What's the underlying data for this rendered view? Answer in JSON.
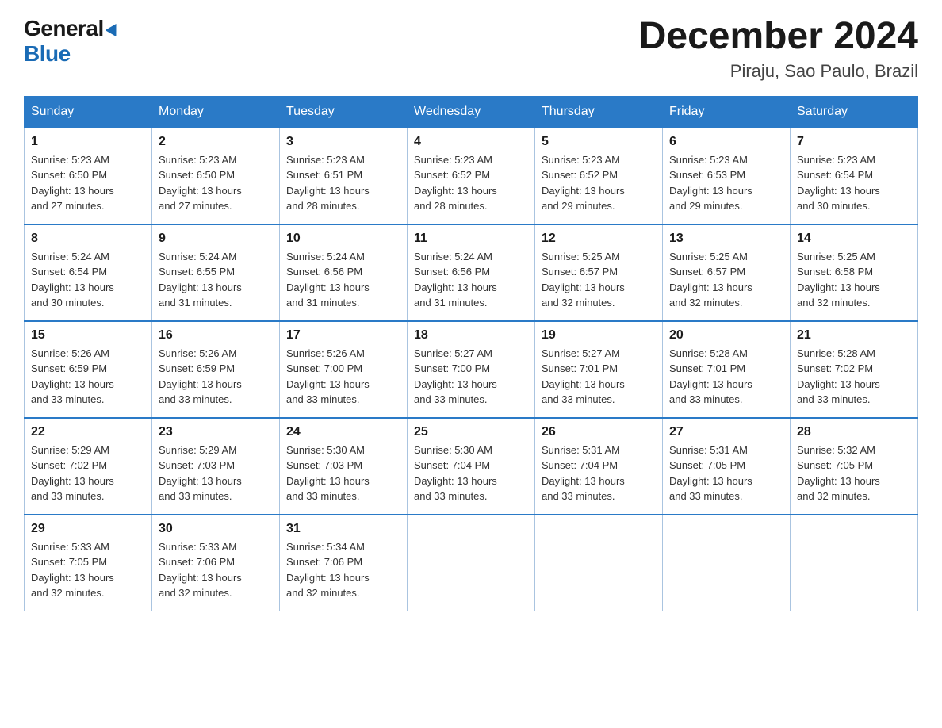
{
  "header": {
    "logo_general": "General",
    "logo_blue": "Blue",
    "month_title": "December 2024",
    "subtitle": "Piraju, Sao Paulo, Brazil"
  },
  "calendar": {
    "days_of_week": [
      "Sunday",
      "Monday",
      "Tuesday",
      "Wednesday",
      "Thursday",
      "Friday",
      "Saturday"
    ],
    "weeks": [
      [
        {
          "num": "1",
          "sunrise": "5:23 AM",
          "sunset": "6:50 PM",
          "daylight": "13 hours and 27 minutes."
        },
        {
          "num": "2",
          "sunrise": "5:23 AM",
          "sunset": "6:50 PM",
          "daylight": "13 hours and 27 minutes."
        },
        {
          "num": "3",
          "sunrise": "5:23 AM",
          "sunset": "6:51 PM",
          "daylight": "13 hours and 28 minutes."
        },
        {
          "num": "4",
          "sunrise": "5:23 AM",
          "sunset": "6:52 PM",
          "daylight": "13 hours and 28 minutes."
        },
        {
          "num": "5",
          "sunrise": "5:23 AM",
          "sunset": "6:52 PM",
          "daylight": "13 hours and 29 minutes."
        },
        {
          "num": "6",
          "sunrise": "5:23 AM",
          "sunset": "6:53 PM",
          "daylight": "13 hours and 29 minutes."
        },
        {
          "num": "7",
          "sunrise": "5:23 AM",
          "sunset": "6:54 PM",
          "daylight": "13 hours and 30 minutes."
        }
      ],
      [
        {
          "num": "8",
          "sunrise": "5:24 AM",
          "sunset": "6:54 PM",
          "daylight": "13 hours and 30 minutes."
        },
        {
          "num": "9",
          "sunrise": "5:24 AM",
          "sunset": "6:55 PM",
          "daylight": "13 hours and 31 minutes."
        },
        {
          "num": "10",
          "sunrise": "5:24 AM",
          "sunset": "6:56 PM",
          "daylight": "13 hours and 31 minutes."
        },
        {
          "num": "11",
          "sunrise": "5:24 AM",
          "sunset": "6:56 PM",
          "daylight": "13 hours and 31 minutes."
        },
        {
          "num": "12",
          "sunrise": "5:25 AM",
          "sunset": "6:57 PM",
          "daylight": "13 hours and 32 minutes."
        },
        {
          "num": "13",
          "sunrise": "5:25 AM",
          "sunset": "6:57 PM",
          "daylight": "13 hours and 32 minutes."
        },
        {
          "num": "14",
          "sunrise": "5:25 AM",
          "sunset": "6:58 PM",
          "daylight": "13 hours and 32 minutes."
        }
      ],
      [
        {
          "num": "15",
          "sunrise": "5:26 AM",
          "sunset": "6:59 PM",
          "daylight": "13 hours and 33 minutes."
        },
        {
          "num": "16",
          "sunrise": "5:26 AM",
          "sunset": "6:59 PM",
          "daylight": "13 hours and 33 minutes."
        },
        {
          "num": "17",
          "sunrise": "5:26 AM",
          "sunset": "7:00 PM",
          "daylight": "13 hours and 33 minutes."
        },
        {
          "num": "18",
          "sunrise": "5:27 AM",
          "sunset": "7:00 PM",
          "daylight": "13 hours and 33 minutes."
        },
        {
          "num": "19",
          "sunrise": "5:27 AM",
          "sunset": "7:01 PM",
          "daylight": "13 hours and 33 minutes."
        },
        {
          "num": "20",
          "sunrise": "5:28 AM",
          "sunset": "7:01 PM",
          "daylight": "13 hours and 33 minutes."
        },
        {
          "num": "21",
          "sunrise": "5:28 AM",
          "sunset": "7:02 PM",
          "daylight": "13 hours and 33 minutes."
        }
      ],
      [
        {
          "num": "22",
          "sunrise": "5:29 AM",
          "sunset": "7:02 PM",
          "daylight": "13 hours and 33 minutes."
        },
        {
          "num": "23",
          "sunrise": "5:29 AM",
          "sunset": "7:03 PM",
          "daylight": "13 hours and 33 minutes."
        },
        {
          "num": "24",
          "sunrise": "5:30 AM",
          "sunset": "7:03 PM",
          "daylight": "13 hours and 33 minutes."
        },
        {
          "num": "25",
          "sunrise": "5:30 AM",
          "sunset": "7:04 PM",
          "daylight": "13 hours and 33 minutes."
        },
        {
          "num": "26",
          "sunrise": "5:31 AM",
          "sunset": "7:04 PM",
          "daylight": "13 hours and 33 minutes."
        },
        {
          "num": "27",
          "sunrise": "5:31 AM",
          "sunset": "7:05 PM",
          "daylight": "13 hours and 33 minutes."
        },
        {
          "num": "28",
          "sunrise": "5:32 AM",
          "sunset": "7:05 PM",
          "daylight": "13 hours and 32 minutes."
        }
      ],
      [
        {
          "num": "29",
          "sunrise": "5:33 AM",
          "sunset": "7:05 PM",
          "daylight": "13 hours and 32 minutes."
        },
        {
          "num": "30",
          "sunrise": "5:33 AM",
          "sunset": "7:06 PM",
          "daylight": "13 hours and 32 minutes."
        },
        {
          "num": "31",
          "sunrise": "5:34 AM",
          "sunset": "7:06 PM",
          "daylight": "13 hours and 32 minutes."
        },
        null,
        null,
        null,
        null
      ]
    ],
    "labels": {
      "sunrise": "Sunrise:",
      "sunset": "Sunset:",
      "daylight": "Daylight:"
    }
  }
}
